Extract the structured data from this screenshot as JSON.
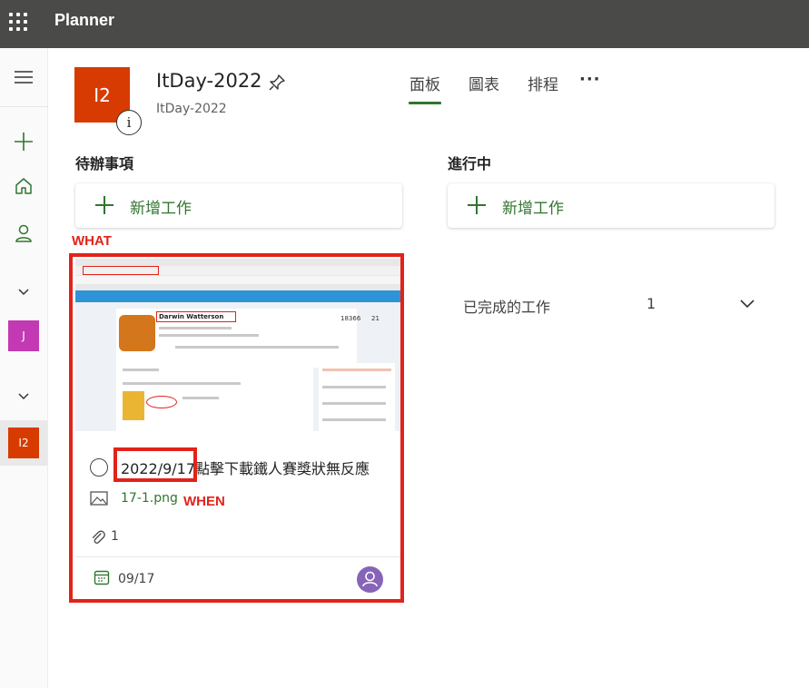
{
  "app": {
    "title": "Planner"
  },
  "rail": {
    "items": [
      {
        "name": "menu",
        "icon": "hamburger-icon"
      },
      {
        "name": "new-plan",
        "icon": "plus-icon"
      },
      {
        "name": "home",
        "icon": "home-icon"
      },
      {
        "name": "assigned",
        "icon": "person-icon"
      },
      {
        "name": "expand-1",
        "icon": "chevron-down-icon"
      },
      {
        "name": "group-j",
        "label": "J",
        "color": "#c239b3"
      },
      {
        "name": "expand-2",
        "icon": "chevron-down-icon"
      },
      {
        "name": "plan-i2",
        "label": "I2",
        "color": "#d83b01"
      }
    ]
  },
  "plan": {
    "tile_label": "I2",
    "tile_color": "#d83b01",
    "info_label": "i",
    "name": "ItDay-2022",
    "group": "ItDay-2022"
  },
  "tabs": [
    {
      "label": "面板",
      "active": true
    },
    {
      "label": "圖表",
      "active": false
    },
    {
      "label": "排程",
      "active": false
    }
  ],
  "more_label": "···",
  "buckets": [
    {
      "title": "待辦事項",
      "add_label": "新增工作"
    },
    {
      "title": "進行中",
      "add_label": "新增工作"
    }
  ],
  "completed": {
    "label": "已完成的工作",
    "count": "1"
  },
  "annotations": {
    "what": "WHAT",
    "when": "WHEN"
  },
  "task": {
    "title": "2022/9/17點擊下載鐵人賽獎狀無反應",
    "attachment": "17-1.png",
    "attachment_count": "1",
    "due": "09/17",
    "assignee_color": "#8764b8",
    "preview": {
      "profile_name": "Darwin Watterson",
      "stat_1": "18366",
      "stat_2": "21"
    }
  },
  "colors": {
    "accent": "#31752f",
    "annotation": "#e2231a",
    "topbar": "#4a4a48"
  }
}
